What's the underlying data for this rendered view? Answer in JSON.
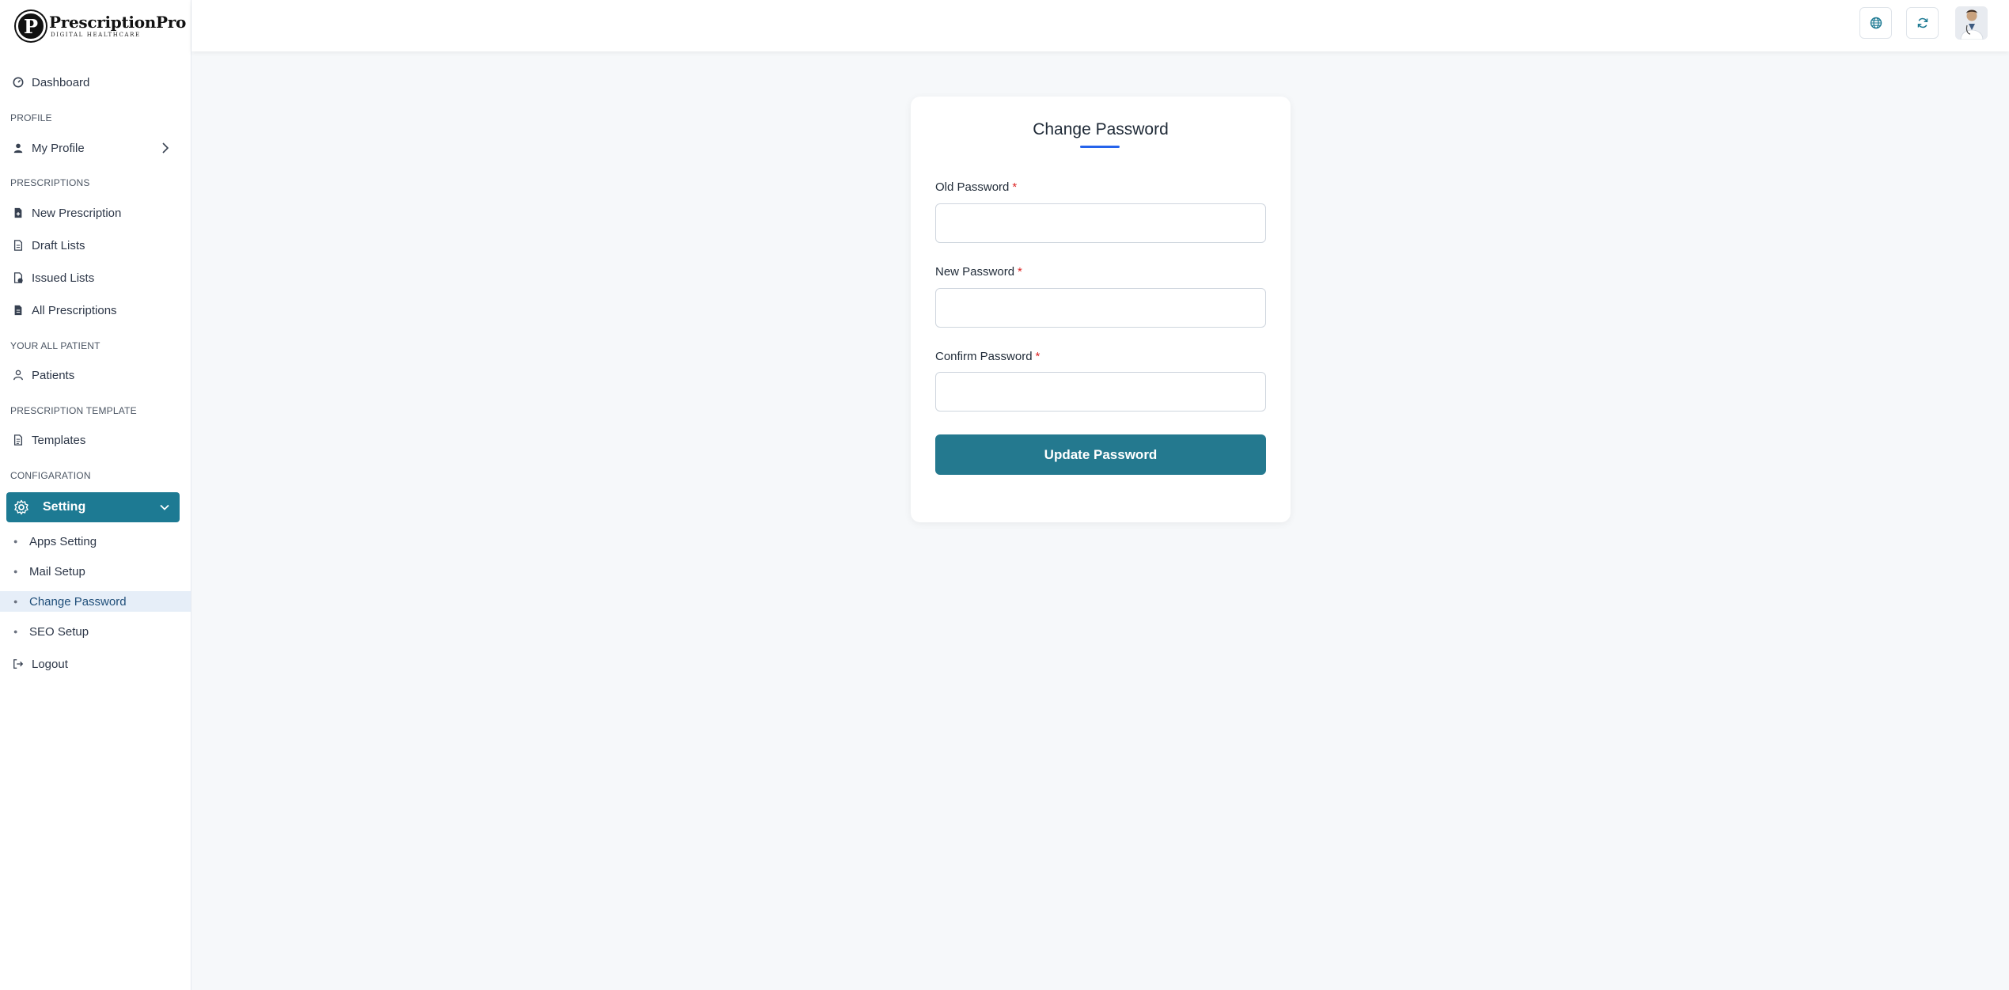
{
  "brand": {
    "mark": "P",
    "title": "PrescriptionPro",
    "subtitle": "DIGITAL HEALTHCARE"
  },
  "sidebar": {
    "dashboard": "Dashboard",
    "sections": {
      "profile": "PROFILE",
      "prescriptions": "PRESCRIPTIONS",
      "patients": "YOUR ALL PATIENT",
      "template": "PRESCRIPTION TEMPLATE",
      "config": "CONFIGARATION"
    },
    "my_profile": "My Profile",
    "new_prescription": "New Prescription",
    "draft_lists": "Draft Lists",
    "issued_lists": "Issued Lists",
    "all_prescriptions": "All Prescriptions",
    "patients": "Patients",
    "templates": "Templates",
    "setting": "Setting",
    "sub_items": {
      "apps_setting": "Apps Setting",
      "mail_setup": "Mail Setup",
      "change_password": "Change Password",
      "seo_setup": "SEO Setup"
    },
    "logout": "Logout"
  },
  "header": {
    "icons": [
      "globe-icon",
      "refresh-icon"
    ]
  },
  "form": {
    "title": "Change Password",
    "old_password_label": "Old Password",
    "new_password_label": "New Password",
    "confirm_password_label": "Confirm Password",
    "required_mark": "*",
    "old_password_value": "",
    "new_password_value": "",
    "confirm_password_value": "",
    "submit_label": "Update Password"
  },
  "colors": {
    "accent": "#1d7a93",
    "button": "#24798f",
    "title_underline": "#2563eb",
    "required": "#dc2626",
    "active_sub_bg": "#e6eef8"
  }
}
